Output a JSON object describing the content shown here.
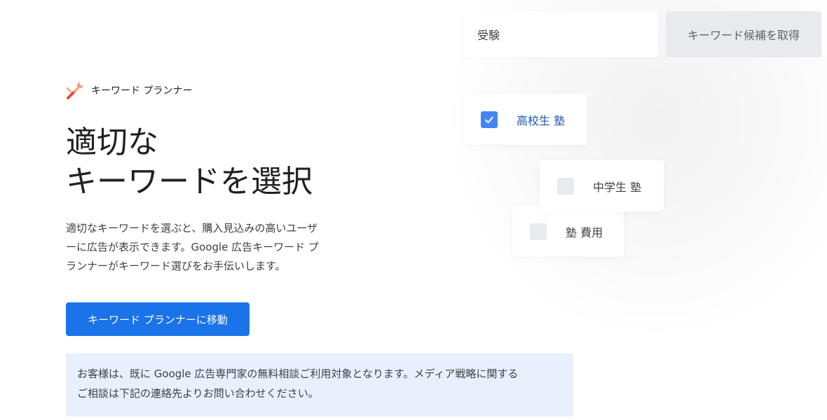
{
  "product": {
    "name": "キーワード プランナー",
    "icon": "wrench-screwdriver-icon"
  },
  "headline": {
    "line1": "適切な",
    "line2": "キーワードを選択"
  },
  "description": {
    "line1": "適切なキーワードを選ぶと、購入見込みの高いユーザ",
    "line2": "ーに広告が表示できます。Google 広告キーワード プ",
    "line3": "ランナーがキーワード選びをお手伝いします。"
  },
  "cta": {
    "label": "キーワード プランナーに移動"
  },
  "notice": {
    "line1": "お客様は、既に Google 広告専門家の無料相談ご利用対象となります。メディア戦略に関する",
    "line2": "ご相談は下記の連絡先よりお問い合わせください。"
  },
  "visual": {
    "search_value": "受験",
    "get_button_label": "キーワード候補を取得",
    "keywords": [
      {
        "label": "高校生 塾",
        "checked": true
      },
      {
        "label": "中学生 塾",
        "checked": false
      },
      {
        "label": "塾 費用",
        "checked": false
      }
    ]
  },
  "colors": {
    "primary": "#1a73e8",
    "checkbox_checked": "#4285f4",
    "notice_bg": "#e8f0fe",
    "logo_red": "#ea4335",
    "logo_orange": "#f6a17a"
  }
}
